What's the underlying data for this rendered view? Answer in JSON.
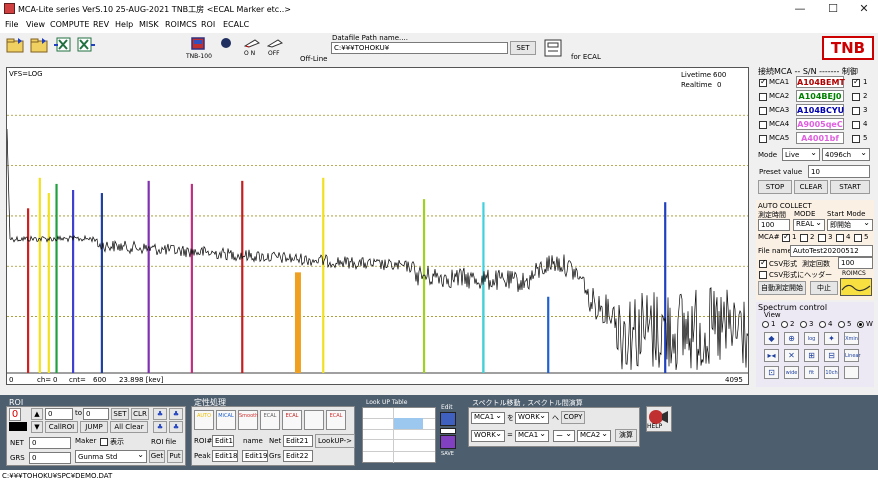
{
  "window": {
    "title": "MCA-Lite series   VerS.10  25-AUG-2021 TNB工房  <ECAL Marker etc..>",
    "minimize": "—",
    "maximize": "☐",
    "close": "✕"
  },
  "menu": [
    "File",
    "View",
    "COMPUTE",
    "REV",
    "Help",
    "MISK",
    "ROIMCS",
    "ROI",
    "ECALC"
  ],
  "toolbar": {
    "tnb100": "TNB-100",
    "on": "O N",
    "off": "OFF",
    "offline": "Off-Line",
    "datafile_label": "Datafile Path name....",
    "datafile_value": "C:¥¥¥TOHOKU¥",
    "set": "SET",
    "for_ecal": "for ECAL",
    "logo": "TNB"
  },
  "spectrum": {
    "vfs": "VFS=LOG",
    "livetime_label": "Livetime",
    "livetime_value": "600",
    "realtime_label": "Realtime",
    "realtime_value": "0",
    "x_start": "0",
    "ch_label": "ch=",
    "ch_value": "0",
    "cnt_label": "cnt=",
    "cnt_value": "600",
    "kev": "23.898 [kev]",
    "x_end": "4095",
    "markers": [
      {
        "ch": 100,
        "color": "#d02020",
        "top": 0.46
      },
      {
        "ch": 165,
        "color": "#f0e020",
        "top": 0.36
      },
      {
        "ch": 215,
        "color": "#f0e020",
        "top": 0.41
      },
      {
        "ch": 258,
        "color": "#20a040",
        "top": 0.38
      },
      {
        "ch": 350,
        "color": "#4040d0",
        "top": 0.4
      },
      {
        "ch": 510,
        "color": "#2040a0",
        "top": 0.41
      },
      {
        "ch": 770,
        "color": "#8030b0",
        "top": 0.37
      },
      {
        "ch": 1010,
        "color": "#c03080",
        "top": 0.38
      },
      {
        "ch": 1290,
        "color": "#c02020",
        "top": 0.37
      },
      {
        "ch": 1600,
        "color": "#f0a020",
        "top": 0.67
      },
      {
        "ch": 1740,
        "color": "#f0e020",
        "top": 0.36
      },
      {
        "ch": 2300,
        "color": "#a0d020",
        "top": 0.43
      },
      {
        "ch": 2630,
        "color": "#20b040",
        "top": 0.71
      },
      {
        "ch": 2630,
        "color": "#40d0e0",
        "top": 0.44
      },
      {
        "ch": 2990,
        "color": "#2060d0",
        "top": 0.75
      },
      {
        "ch": 3640,
        "color": "#2040c0",
        "top": 0.44
      }
    ]
  },
  "right": {
    "header": "接続MCA -- S/N  -------  制御",
    "mcas": [
      {
        "label": "MCA1",
        "sn": "A104BEMT",
        "color": "#b00000",
        "on": true,
        "idx": "1",
        "ctl": true
      },
      {
        "label": "MCA2",
        "sn": "A104BEJ0",
        "color": "#008000",
        "on": false,
        "idx": "2",
        "ctl": false
      },
      {
        "label": "MCA3",
        "sn": "A104BCYU",
        "color": "#0000b0",
        "on": false,
        "idx": "3",
        "ctl": false
      },
      {
        "label": "MCA4",
        "sn": "A9005qeC",
        "color": "#e060e0",
        "on": false,
        "idx": "4",
        "ctl": false
      },
      {
        "label": "MCA5",
        "sn": "A4001bf",
        "color": "#e060e0",
        "on": false,
        "idx": "5",
        "ctl": false
      }
    ],
    "mode_label": "Mode",
    "mode_value": "Live",
    "ch_value": "4096ch",
    "preset_label": "Preset value",
    "preset_value": "10",
    "stop": "STOP",
    "clear": "CLEAR",
    "start": "START"
  },
  "auto": {
    "title": "AUTO COLLECT",
    "time_label": "測定時間",
    "mode_label": "MODE",
    "start_mode_label": "Start Mode",
    "time_value": "100",
    "mode_value": "REAL",
    "start_mode_value": "即開始",
    "mca_label": "MCA#",
    "nums": [
      "1",
      "2",
      "3",
      "4",
      "5"
    ],
    "file_label": "File name",
    "file_value": "AutoTest20200512",
    "csv1": "CSV形式",
    "count_label": "測定回数",
    "count_value": "100",
    "csv2": "CSV形式にヘッダー",
    "roimcs": "ROIMCS",
    "auto_start": "自動測定開始",
    "stop": "中止"
  },
  "specctrl": {
    "title": "Spectrum control",
    "view": "View",
    "radios": [
      "1",
      "2",
      "3",
      "4",
      "5",
      "W"
    ],
    "icons": [
      "◆",
      "⊕",
      "log",
      "✦",
      "Xmin",
      "▸◂",
      "✕",
      "⊞",
      "⊟",
      "Linear",
      "⊡",
      "wide",
      "fit",
      "10ch",
      ""
    ]
  },
  "roi": {
    "title": "ROI",
    "index": "0",
    "from": "0",
    "to_label": "to",
    "to": "0",
    "set": "SET",
    "clr": "CLR",
    "callroi": "CallROI",
    "jump": "JUMP",
    "allclear": "All Clear",
    "net_label": "NET",
    "net": "0",
    "maker_label": "Maker",
    "display": "表示",
    "roifile": "ROI file",
    "grs_label": "GRS",
    "grs": "0",
    "gunma": "Gunma Std",
    "get": "Get",
    "put": "Put"
  },
  "teisei": {
    "title": "定性処理",
    "icons": [
      "AUTO",
      "MiCAL",
      "Smooth",
      "ECAL",
      "ECAL",
      "",
      "ECAL"
    ],
    "roi_label": "ROI#",
    "edit1": "Edit1",
    "name_label": "name",
    "net_label": "Net",
    "edit21": "Edit21",
    "lookup": "LookUP->",
    "peak_label": "Peak",
    "edit18": "Edit18",
    "edit19": "Edit19",
    "grs_label": "Grs",
    "edit22": "Edit22"
  },
  "lookup": {
    "title": "Look UP Table",
    "edit": "Edit",
    "save": "SAVE"
  },
  "spmove": {
    "title": "スペクトル移動 , スペクトル間演算",
    "a1": "MCA1",
    "to_label": "を",
    "a2": "WORK",
    "he": "へ",
    "copy": "COPY",
    "b1": "WORK",
    "eq": "=",
    "b2": "MCA1",
    "op": "ー",
    "b3": "MCA2",
    "calc": "演算"
  },
  "help": "HELP",
  "status": "C:¥¥¥TOHOKU¥SPC¥DEMO.DAT"
}
